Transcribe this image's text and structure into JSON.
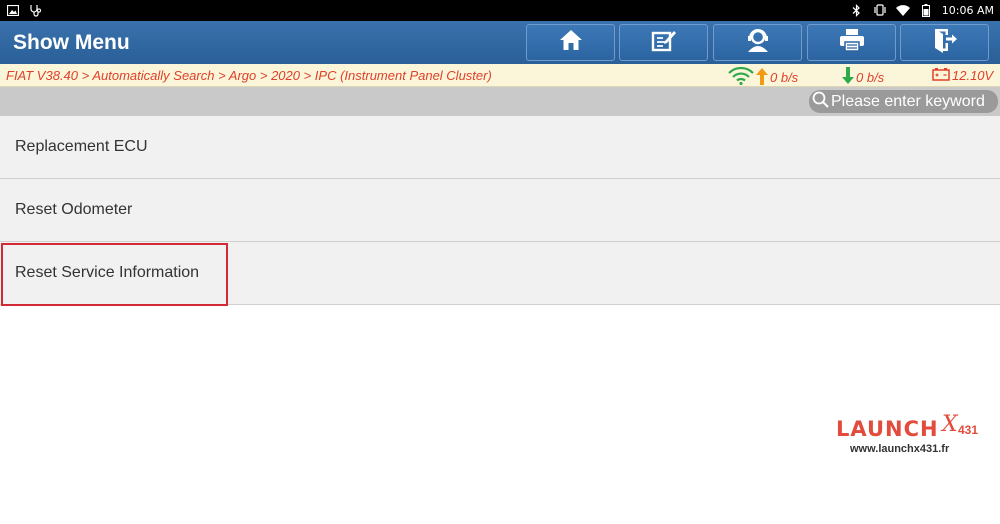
{
  "statusbar": {
    "time": "10:06 AM",
    "left_icons": [
      "image-icon",
      "stethoscope-icon"
    ],
    "right_icons": [
      "bluetooth-icon",
      "vibrate-icon",
      "wifi-icon",
      "battery-icon"
    ]
  },
  "header": {
    "title": "Show Menu",
    "buttons": [
      {
        "name": "home-button",
        "icon": "home-icon"
      },
      {
        "name": "edit-button",
        "icon": "edit-icon"
      },
      {
        "name": "support-button",
        "icon": "support-icon"
      },
      {
        "name": "print-button",
        "icon": "print-icon"
      },
      {
        "name": "exit-button",
        "icon": "exit-icon"
      }
    ]
  },
  "infobar": {
    "breadcrumb": "FIAT V38.40 > Automatically Search > Argo > 2020 > IPC (Instrument Panel Cluster)",
    "upload": "0 b/s",
    "download": "0 b/s",
    "voltage": "12.10V"
  },
  "search": {
    "placeholder": "Please enter keyword"
  },
  "menu": {
    "items": [
      {
        "label": "Replacement ECU"
      },
      {
        "label": "Reset Odometer"
      },
      {
        "label": "Reset Service Information",
        "selected": true
      }
    ]
  },
  "watermark": {
    "brand": "LAUNCH",
    "x": "X",
    "model": "431",
    "url": "www.launchx431.fr"
  },
  "colors": {
    "header_blue": "#2f68a3",
    "breadcrumb_red": "#e0402a",
    "highlight_red": "#d42a35",
    "upload_orange": "#f29a12",
    "download_green": "#2fa84a",
    "wifi_green": "#2fa84a"
  }
}
